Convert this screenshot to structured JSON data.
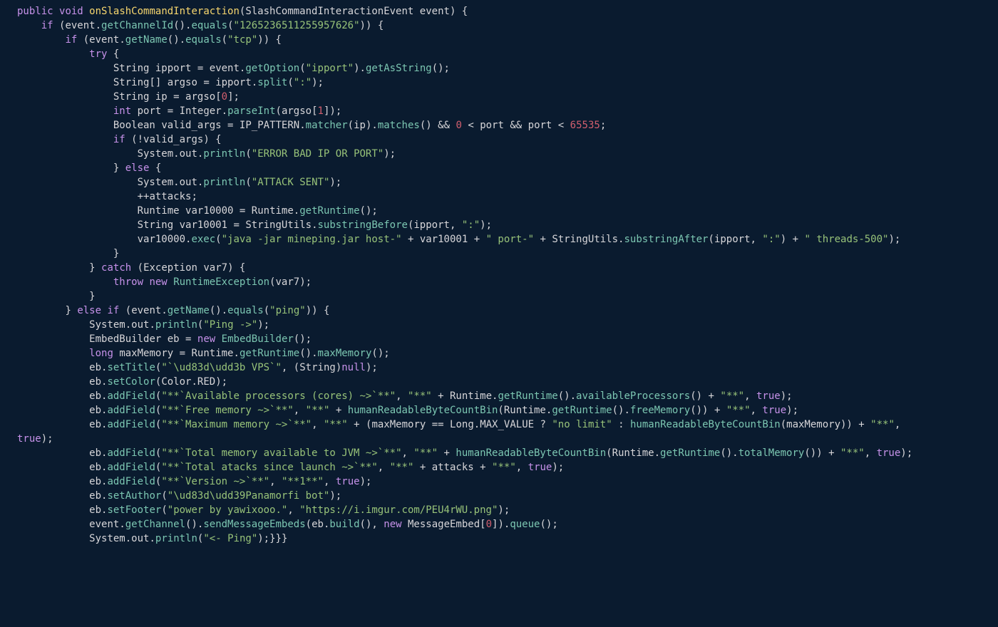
{
  "code": {
    "method_name": "onSlashCommandInteraction",
    "param_type": "SlashCommandInteractionEvent",
    "param_name": "event",
    "channel_id": "1265236511255957626",
    "cmd_tcp": "tcp",
    "cmd_ping": "ping",
    "option_ipport": "ipport",
    "split_colon": ":",
    "idx0": "0",
    "idx1": "1",
    "zero": "0",
    "port_max": "65535",
    "err_msg": "ERROR BAD IP OR PORT",
    "attack_msg": "ATTACK SENT",
    "colon_lit": ":",
    "exec_prefix": "java -jar mineping.jar host-",
    "exec_port": " port-",
    "exec_threads": " threads-500",
    "ping_out": "Ping ->",
    "title_lit": "`\\ud83d\\udd3b VPS`",
    "f_cores": "**`Available processors (cores) ~>`**",
    "f_free": "**`Free memory ~>`**",
    "f_max": "**`Maximum memory ~>`**",
    "f_total": "**`Total memory available to JVM ~>`**",
    "f_attacks": "**`Total atacks since launch ~>`**",
    "f_version": "**`Version ~>`**",
    "star2": "**",
    "no_limit": "no limit",
    "version": "**1**",
    "author": "\\ud83d\\udd39Panamorfi bot",
    "footer_text": "power by yawixooo.",
    "footer_url": "https://i.imgur.com/PEU4rWU.png",
    "ping_done": "<- Ping"
  }
}
